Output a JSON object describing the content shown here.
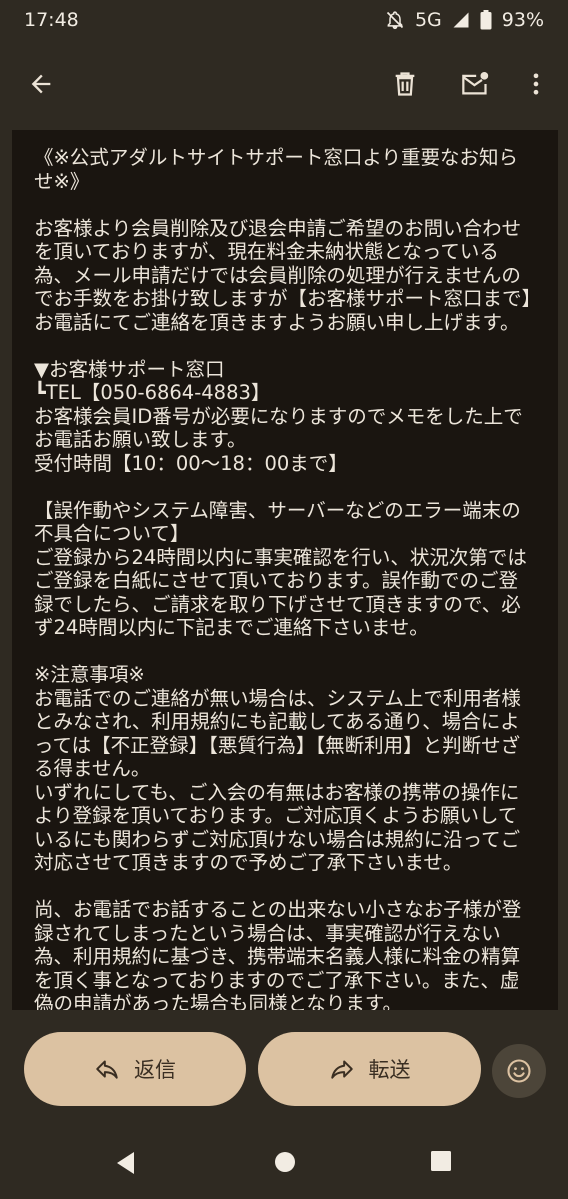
{
  "status": {
    "time": "17:48",
    "network": "5G",
    "battery": "93%"
  },
  "appbar": {
    "back_icon": "arrow-left-icon",
    "delete_icon": "trash-icon",
    "unread_icon": "mail-unread-icon",
    "more_icon": "more-vert-icon"
  },
  "email": {
    "body": "《※公式アダルトサイトサポート窓口より重要なお知らせ※》\n\nお客様より会員削除及び退会申請ご希望のお問い合わせを頂いておりますが、現在料金未納状態となっている為、メール申請だけでは会員削除の処理が行えませんのでお手数をお掛け致しますが【お客様サポート窓口まで】お電話にてご連絡を頂きますようお願い申し上げます。\n\n▼お客様サポート窓口\n┗TEL【050-6864-4883】\nお客様会員ID番号が必要になりますのでメモをした上でお電話お願い致します。\n受付時間【10：00〜18：00まで】\n\n【誤作動やシステム障害、サーバーなどのエラー端末の不具合について】\nご登録から24時間以内に事実確認を行い、状況次第ではご登録を白紙にさせて頂いております。誤作動でのご登録でしたら、ご請求を取り下げさせて頂きますので、必ず24時間以内に下記までご連絡下さいませ。\n\n※注意事項※\nお電話でのご連絡が無い場合は、システム上で利用者様とみなされ、利用規約にも記載してある通り、場合によっては【不正登録】【悪質行為】【無断利用】と判断せざる得ません。\nいずれにしても、ご入会の有無はお客様の携帯の操作により登録を頂いております。ご対応頂くようお願いしているにも関わらずご対応頂けない場合は規約に沿ってご対応させて頂きますので予めご了承下さいませ。\n\n尚、お電話でお話することの出来ない小さなお子様が登録されてしまったという場合は、事実確認が行えない為、利用規約に基づき、携帯端末名義人様に料金の精算を頂く事となっておりますのでご了承下さい。また、虚偽の申請があった場合も同様となります。"
  },
  "actions": {
    "reply_label": "返信",
    "forward_label": "転送"
  },
  "colors": {
    "background": "#2f2a22",
    "content_background": "#1a1510",
    "pill": "#dcc2a2"
  }
}
